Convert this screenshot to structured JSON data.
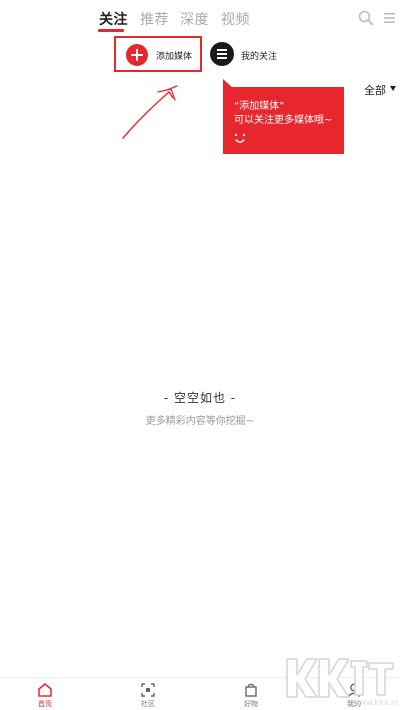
{
  "tabs": [
    {
      "label": "关注",
      "active": true
    },
    {
      "label": "推荐",
      "active": false
    },
    {
      "label": "深度",
      "active": false
    },
    {
      "label": "视频",
      "active": false
    }
  ],
  "top_icons": {
    "search": "search-icon",
    "menu": "menu-icon"
  },
  "media_row": {
    "add_media_label": "添加媒体",
    "my_follow_label": "我的关注"
  },
  "filter": {
    "label": "全部"
  },
  "tooltip": {
    "line1": "“添加媒体”",
    "line2": "可以关注更多媒体哦~"
  },
  "empty_state": {
    "title": "- 空空如也 -",
    "subtitle": "更多精彩内容等你挖掘~"
  },
  "bottom_nav": [
    {
      "label": "首页",
      "icon": "home-icon",
      "active": true
    },
    {
      "label": "社区",
      "icon": "community-icon",
      "active": false
    },
    {
      "label": "好物",
      "icon": "bag-icon",
      "active": false
    },
    {
      "label": "我的",
      "icon": "user-icon",
      "active": false
    }
  ],
  "watermark": {
    "text": "KK下载",
    "domain": "www.kkx.net"
  },
  "colors": {
    "accent": "#e8262d",
    "text": "#222222",
    "muted": "#a9a9a9"
  }
}
